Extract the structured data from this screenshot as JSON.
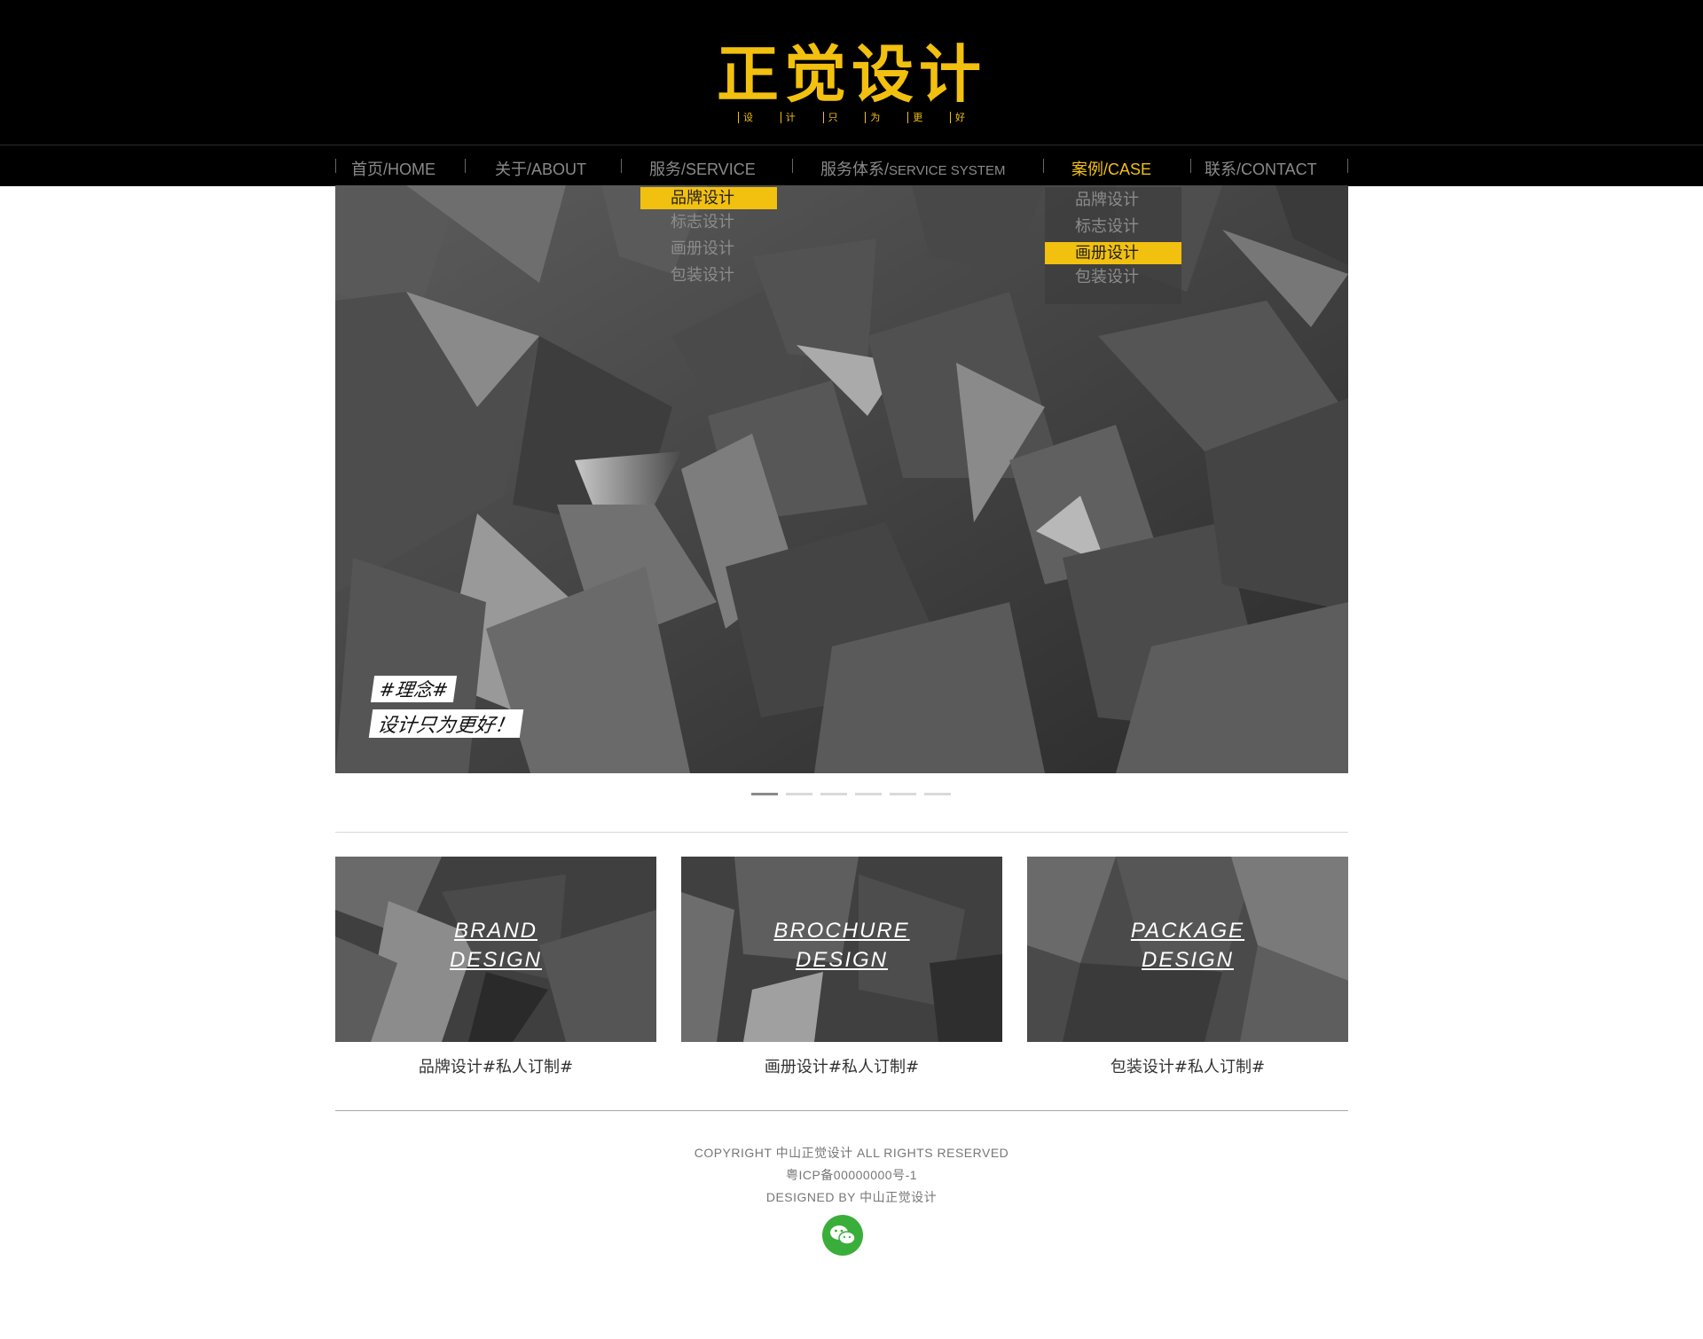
{
  "brand": {
    "logo": "正觉设计",
    "tagline": [
      "设",
      "计",
      "只",
      "为",
      "更",
      "好"
    ]
  },
  "nav": [
    {
      "label": "首页/HOME"
    },
    {
      "label": "关于/ABOUT"
    },
    {
      "label": "服务/SERVICE"
    },
    {
      "label_cn": "服务体系/",
      "label_en": "SERVICE SYSTEM"
    },
    {
      "label": "案例/CASE",
      "active": true
    },
    {
      "label": "联系/CONTACT"
    }
  ],
  "service_dropdown": [
    "品牌设计",
    "标志设计",
    "画册设计",
    "包装设计"
  ],
  "case_dropdown": [
    "品牌设计",
    "标志设计",
    "画册设计",
    "包装设计"
  ],
  "hero": {
    "tag1": "#理念#",
    "tag2": "设计只为更好！",
    "slides_total": 6,
    "slide_current": 1
  },
  "cards": [
    {
      "line1": "BRAND",
      "line2": "DESIGN",
      "label": "品牌设计#私人订制#"
    },
    {
      "line1": "BROCHURE",
      "line2": "DESIGN",
      "label": "画册设计#私人订制#"
    },
    {
      "line1": "PACKAGE",
      "line2": "DESIGN",
      "label": "包装设计#私人订制#"
    }
  ],
  "footer": {
    "copyright": "COPYRIGHT 中山正觉设计 ALL RIGHTS RESERVED",
    "icp": "粤ICP备00000000号-1",
    "designed": "DESIGNED BY 中山正觉设计",
    "wechat_icon": "wechat-icon"
  },
  "colors": {
    "accent": "#f2c00f",
    "header_bg": "#000000",
    "wechat": "#3aae3a"
  }
}
